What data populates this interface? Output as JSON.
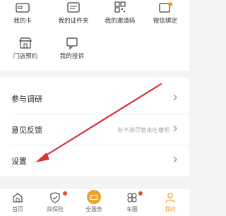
{
  "grid": {
    "items": [
      {
        "label": "我的卡",
        "icon": "card-icon"
      },
      {
        "label": "我的证件夹",
        "icon": "folder-icon"
      },
      {
        "label": "我的邀请码",
        "icon": "qrcode-icon"
      },
      {
        "label": "微信绑定",
        "icon": "wechat-bind-icon"
      },
      {
        "label": "门店预约",
        "icon": "store-booking-icon"
      },
      {
        "label": "我的投诉",
        "icon": "complaint-icon"
      }
    ]
  },
  "list": {
    "items": [
      {
        "label": "参与调研",
        "hint": ""
      },
      {
        "label": "意见反馈",
        "hint": "有不满尽管来吐槽吧"
      },
      {
        "label": "设置",
        "hint": ""
      }
    ]
  },
  "tabs": [
    {
      "label": "首页",
      "icon": "home-icon"
    },
    {
      "label": "找保险",
      "icon": "shield-icon"
    },
    {
      "label": "全服务",
      "icon": "car-service-icon"
    },
    {
      "label": "车圈",
      "icon": "circles-icon"
    },
    {
      "label": "我的",
      "icon": "profile-icon"
    }
  ],
  "colors": {
    "accent": "#f0a02c",
    "badge": "#e8493d",
    "annotation_arrow": "#d8323a"
  }
}
